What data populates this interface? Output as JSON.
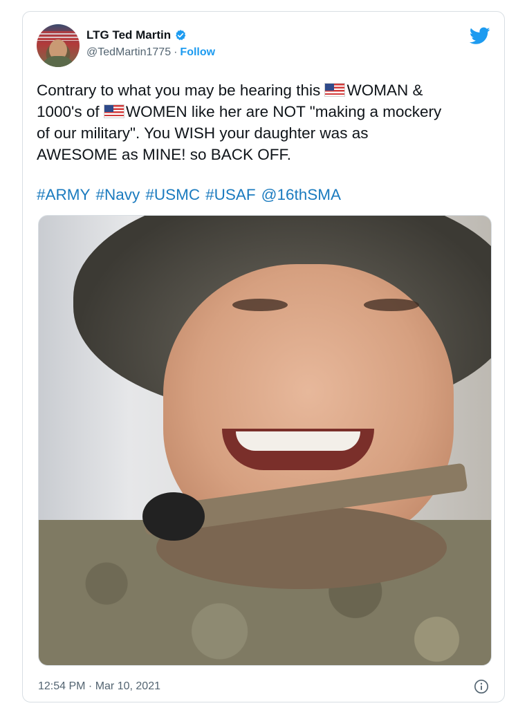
{
  "tweet": {
    "author": {
      "display_name": "LTG Ted Martin",
      "handle": "@TedMartin1775",
      "separator": "·",
      "follow_label": "Follow",
      "verified": true
    },
    "text_lines": [
      {
        "before_flag": "Contrary to what you may be hearing this ",
        "after_flag": "WOMAN &"
      },
      {
        "before_flag": "1000's of ",
        "after_flag": "WOMEN like her are NOT \"making a mockery"
      },
      {
        "plain": "of our military\". You WISH your daughter was as"
      },
      {
        "plain": "AWESOME as MINE! so BACK OFF."
      }
    ],
    "hashtags": [
      "#ARMY",
      "#Navy",
      "#USMC",
      "#USAF",
      "@16thSMA"
    ],
    "timestamp": "12:54 PM · Mar 10, 2021",
    "icons": {
      "platform": "twitter-bird-icon",
      "verified": "verified-badge-icon",
      "info": "info-icon",
      "flag": "us-flag-emoji-icon"
    },
    "colors": {
      "link": "#1d9bf0",
      "hashtag": "#1b7bbf",
      "muted": "#536471",
      "text": "#0f1419"
    }
  }
}
